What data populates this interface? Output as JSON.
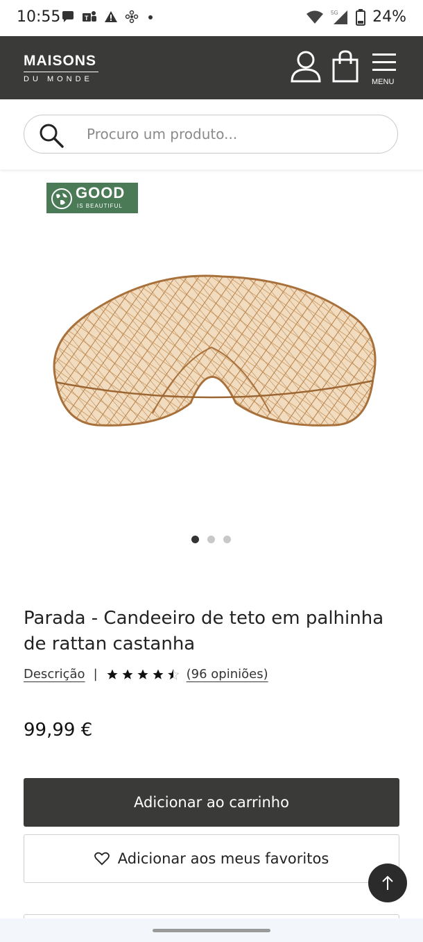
{
  "status_bar": {
    "time": "10:55",
    "battery": "24%",
    "icons_left": [
      "chat-bubble-icon",
      "teams-icon",
      "warning-icon",
      "fan-icon",
      "dot-icon"
    ],
    "icons_right": [
      "wifi-icon",
      "signal-5g-icon",
      "battery-icon"
    ]
  },
  "header": {
    "logo_line1": "MAISONS",
    "logo_line2": "DU MONDE",
    "menu_label": "MENU",
    "icons": [
      "account-icon",
      "shopping-bag-icon",
      "hamburger-menu-icon"
    ]
  },
  "search": {
    "placeholder": "Procuro um produto..."
  },
  "badge": {
    "line1": "GOOD",
    "line2": "IS BEAUTIFUL",
    "color": "#4b7a57"
  },
  "gallery": {
    "total_slides": 3,
    "active_slide": 1
  },
  "product": {
    "title": "Parada - Candeeiro de teto em palhinha de rattan castanha",
    "description_link": "Descrição",
    "separator": "|",
    "rating": 4.5,
    "rating_max": 5,
    "reviews_link": "(96 opiniões)",
    "price": "99,99 €"
  },
  "actions": {
    "add_to_cart": "Adicionar ao carrinho",
    "add_to_favorites": "Adicionar aos meus favoritos"
  },
  "colors": {
    "header_bg": "#3a3a38",
    "primary_button": "#3a3a38",
    "rattan": "#c8955a"
  }
}
